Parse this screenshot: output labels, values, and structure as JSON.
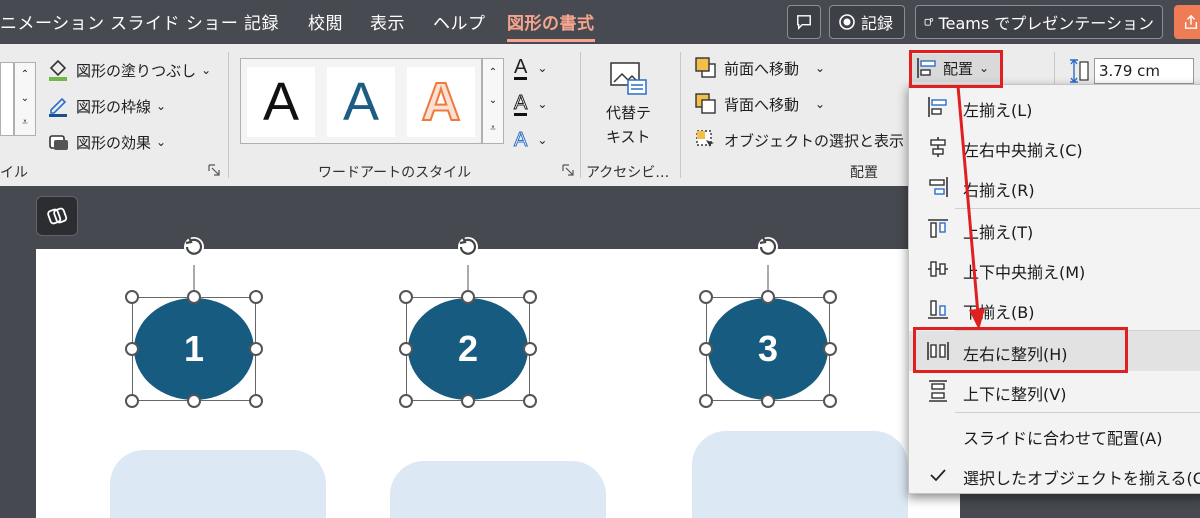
{
  "tabs": [
    {
      "label": "ニメーション"
    },
    {
      "label": "スライド ショー"
    },
    {
      "label": "記録"
    },
    {
      "label": "校閲"
    },
    {
      "label": "表示"
    },
    {
      "label": "ヘルプ"
    },
    {
      "label": "図形の書式"
    }
  ],
  "title_buttons": {
    "record": "記録",
    "teams": "Teams でプレゼンテーション"
  },
  "ribbon": {
    "shape_styles": {
      "fill": "図形の塗りつぶし",
      "outline": "図形の枠線",
      "effects": "図形の効果",
      "group_label_partial": "イル"
    },
    "wordart": {
      "sample_letter": "A",
      "group_label": "ワードアートのスタイル"
    },
    "text_fill_letter": "A",
    "accessibility": {
      "alt_text_line1": "代替テ",
      "alt_text_line2": "キスト",
      "group_label": "アクセシビ…"
    },
    "arrange": {
      "bring_forward": "前面へ移動",
      "send_backward": "背面へ移動",
      "selection_pane": "オブジェクトの選択と表示",
      "align": "配置",
      "group_label": "配置"
    },
    "size": {
      "height": "3.79 cm"
    }
  },
  "slide": {
    "shapes": [
      {
        "label": "1"
      },
      {
        "label": "2"
      },
      {
        "label": "3"
      }
    ]
  },
  "align_menu": {
    "items": [
      {
        "label": "左揃え(L)",
        "icon": "align-left-icon"
      },
      {
        "label": "左右中央揃え(C)",
        "icon": "align-center-icon"
      },
      {
        "label": "右揃え(R)",
        "icon": "align-right-icon"
      },
      {
        "label": "上揃え(T)",
        "icon": "align-top-icon"
      },
      {
        "label": "上下中央揃え(M)",
        "icon": "align-middle-icon"
      },
      {
        "label": "下揃え(B)",
        "icon": "align-bottom-icon"
      },
      {
        "label": "左右に整列(H)",
        "icon": "distribute-horizontal-icon"
      },
      {
        "label": "上下に整列(V)",
        "icon": "distribute-vertical-icon"
      },
      {
        "label": "スライドに合わせて配置(A)",
        "icon": ""
      },
      {
        "label": "選択したオブジェクトを揃える(O)",
        "icon": "checkmark-icon"
      }
    ]
  },
  "colors": {
    "accent_tab": "#f6a48e",
    "shape_fill": "#175c80",
    "highlight": "#e02020",
    "placeholder_fill": "#dce8f4"
  }
}
